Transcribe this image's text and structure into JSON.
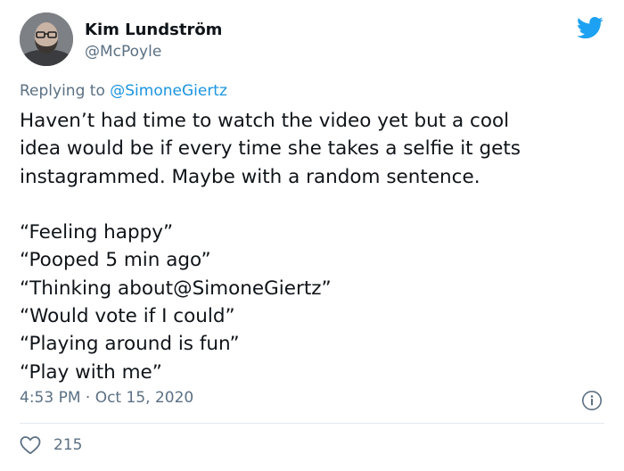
{
  "author": {
    "name": "Kim Lundström",
    "handle": "@McPoyle",
    "avatar": "bald-bearded-man-avatar"
  },
  "icons": {
    "brand": "twitter-bird-icon",
    "info": "info-icon",
    "like": "heart-icon"
  },
  "reply": {
    "prefix": "Replying to ",
    "to": "@SimoneGiertz"
  },
  "tweet": {
    "lines": [
      "Haven’t had time to watch the video yet but a cool",
      "idea would be if every time she takes a selfie it gets",
      "instagrammed. Maybe with a random sentence."
    ],
    "quotes": [
      "“Feeling happy”",
      "“Pooped 5 min ago”",
      "“Thinking about@SimoneGiertz”",
      "“Would vote if I could”",
      "“Playing around is fun”",
      "“Play with me”"
    ]
  },
  "meta": {
    "timestamp": "4:53 PM · Oct 15, 2020",
    "likes": "215"
  },
  "colors": {
    "brand_blue": "#1da1f2",
    "link_blue": "#1b95e0",
    "secondary_text": "#5b7083",
    "divider": "#e1e8ed"
  }
}
